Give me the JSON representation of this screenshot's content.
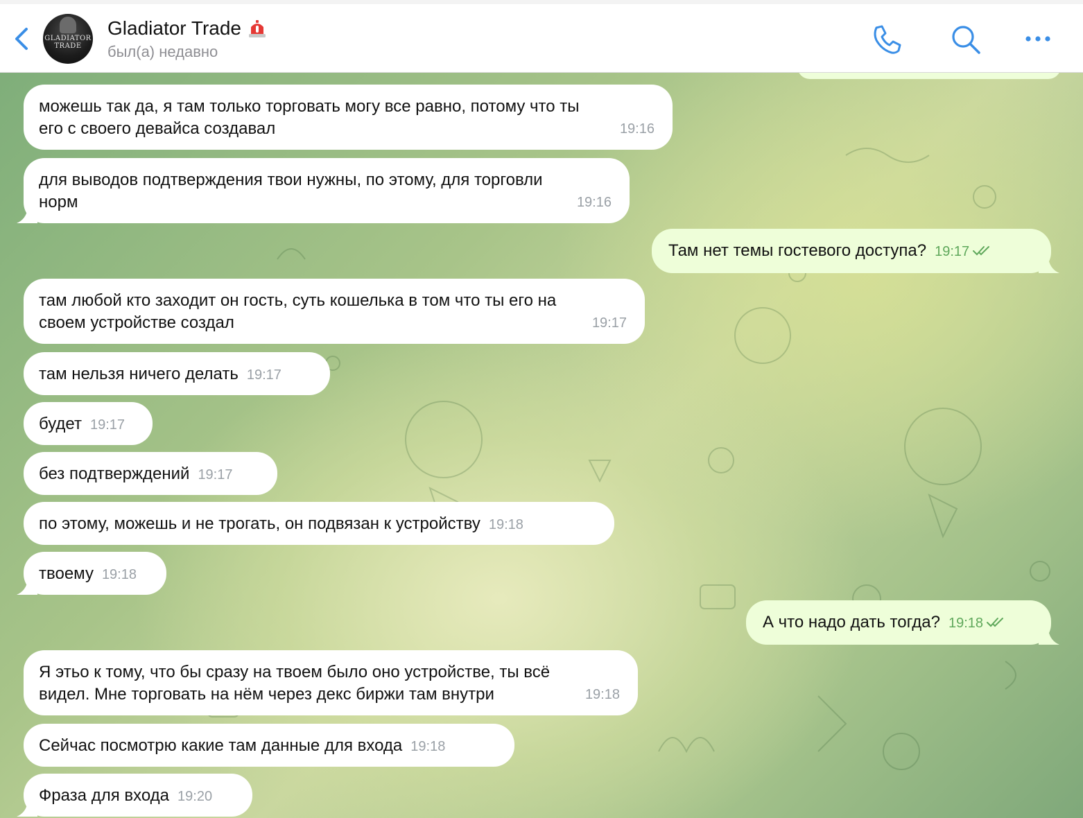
{
  "header": {
    "title": "Gladiator Trade",
    "status": "был(а) недавно",
    "avatar_text": "GLADIATOR\nTRADE"
  },
  "messages": [
    {
      "direction": "in",
      "text": "можешь так да, я там только торговать могу все равно, потому что ты\nего с своего девайса создавал",
      "time": "19:16"
    },
    {
      "direction": "in",
      "text": "для выводов подтверждения твои нужны, по этому, для торговли\nнорм",
      "time": "19:16"
    },
    {
      "direction": "out",
      "text": "Там нет темы гостевого доступа?",
      "time": "19:17"
    },
    {
      "direction": "in",
      "text": "там любой кто заходит он гость, суть кошелька в том что ты его на\nсвоем устройстве создал",
      "time": "19:17"
    },
    {
      "direction": "in",
      "text": "там нельзя ничего делать",
      "time": "19:17"
    },
    {
      "direction": "in",
      "text": "будет",
      "time": "19:17"
    },
    {
      "direction": "in",
      "text": "без подтверждений",
      "time": "19:17"
    },
    {
      "direction": "in",
      "text": "по этому, можешь и не трогать, он подвязан к устройству",
      "time": "19:18"
    },
    {
      "direction": "in",
      "text": "твоему",
      "time": "19:18"
    },
    {
      "direction": "out",
      "text": "А что надо дать тогда?",
      "time": "19:18"
    },
    {
      "direction": "in",
      "text": "Я этьо к тому, что бы сразу на твоем было оно устройстве, ты всё\nвидел. Мне торговать на нём через декс биржи там внутри",
      "time": "19:18"
    },
    {
      "direction": "in",
      "text": "Сейчас посмотрю какие там данные для входа",
      "time": "19:18"
    },
    {
      "direction": "in",
      "text": "Фраза для входа",
      "time": "19:20"
    }
  ],
  "colors": {
    "incoming_bubble": "#ffffff",
    "outgoing_bubble": "#eefed9",
    "accent": "#3a8ee6",
    "outgoing_time": "#5fa85b"
  },
  "icons": {
    "back": "chevron-left-icon",
    "call": "phone-icon",
    "search": "search-icon",
    "more": "more-icon",
    "read": "double-check-icon"
  }
}
